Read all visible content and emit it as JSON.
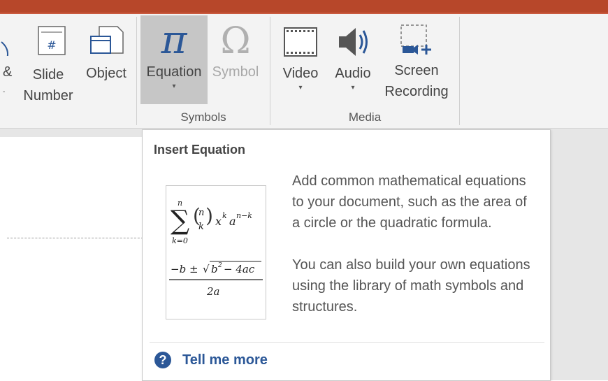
{
  "ribbon": {
    "partial_left_label_1": "&",
    "slide_number": {
      "line1": "Slide",
      "line2": "Number"
    },
    "object": {
      "label": "Object"
    },
    "equation": {
      "label": "Equation"
    },
    "symbol": {
      "label": "Symbol"
    },
    "video": {
      "label": "Video"
    },
    "audio": {
      "label": "Audio"
    },
    "screen_recording": {
      "line1": "Screen",
      "line2": "Recording"
    },
    "groups": {
      "symbols": "Symbols",
      "media": "Media"
    },
    "icons": {
      "slide_number": "slide-number-icon",
      "object": "object-icon",
      "equation": "pi-icon",
      "symbol": "omega-icon",
      "video": "film-icon",
      "audio": "speaker-icon",
      "screen_recording": "screen-recording-icon"
    }
  },
  "tooltip": {
    "title": "Insert Equation",
    "description_1": "Add common mathematical equations to your document, such as the area of a circle or the quadratic formula.",
    "description_2": "You can also build your own equations using the library of math symbols and structures.",
    "help_link": "Tell me more",
    "help_icon": "help-icon"
  },
  "colors": {
    "title_bar": "#b7472a",
    "ribbon_bg": "#f3f3f3",
    "selected_button": "#c6c6c6",
    "link": "#2b5797",
    "equation_icon": "#2b5797",
    "disabled": "#a8a8a8"
  }
}
